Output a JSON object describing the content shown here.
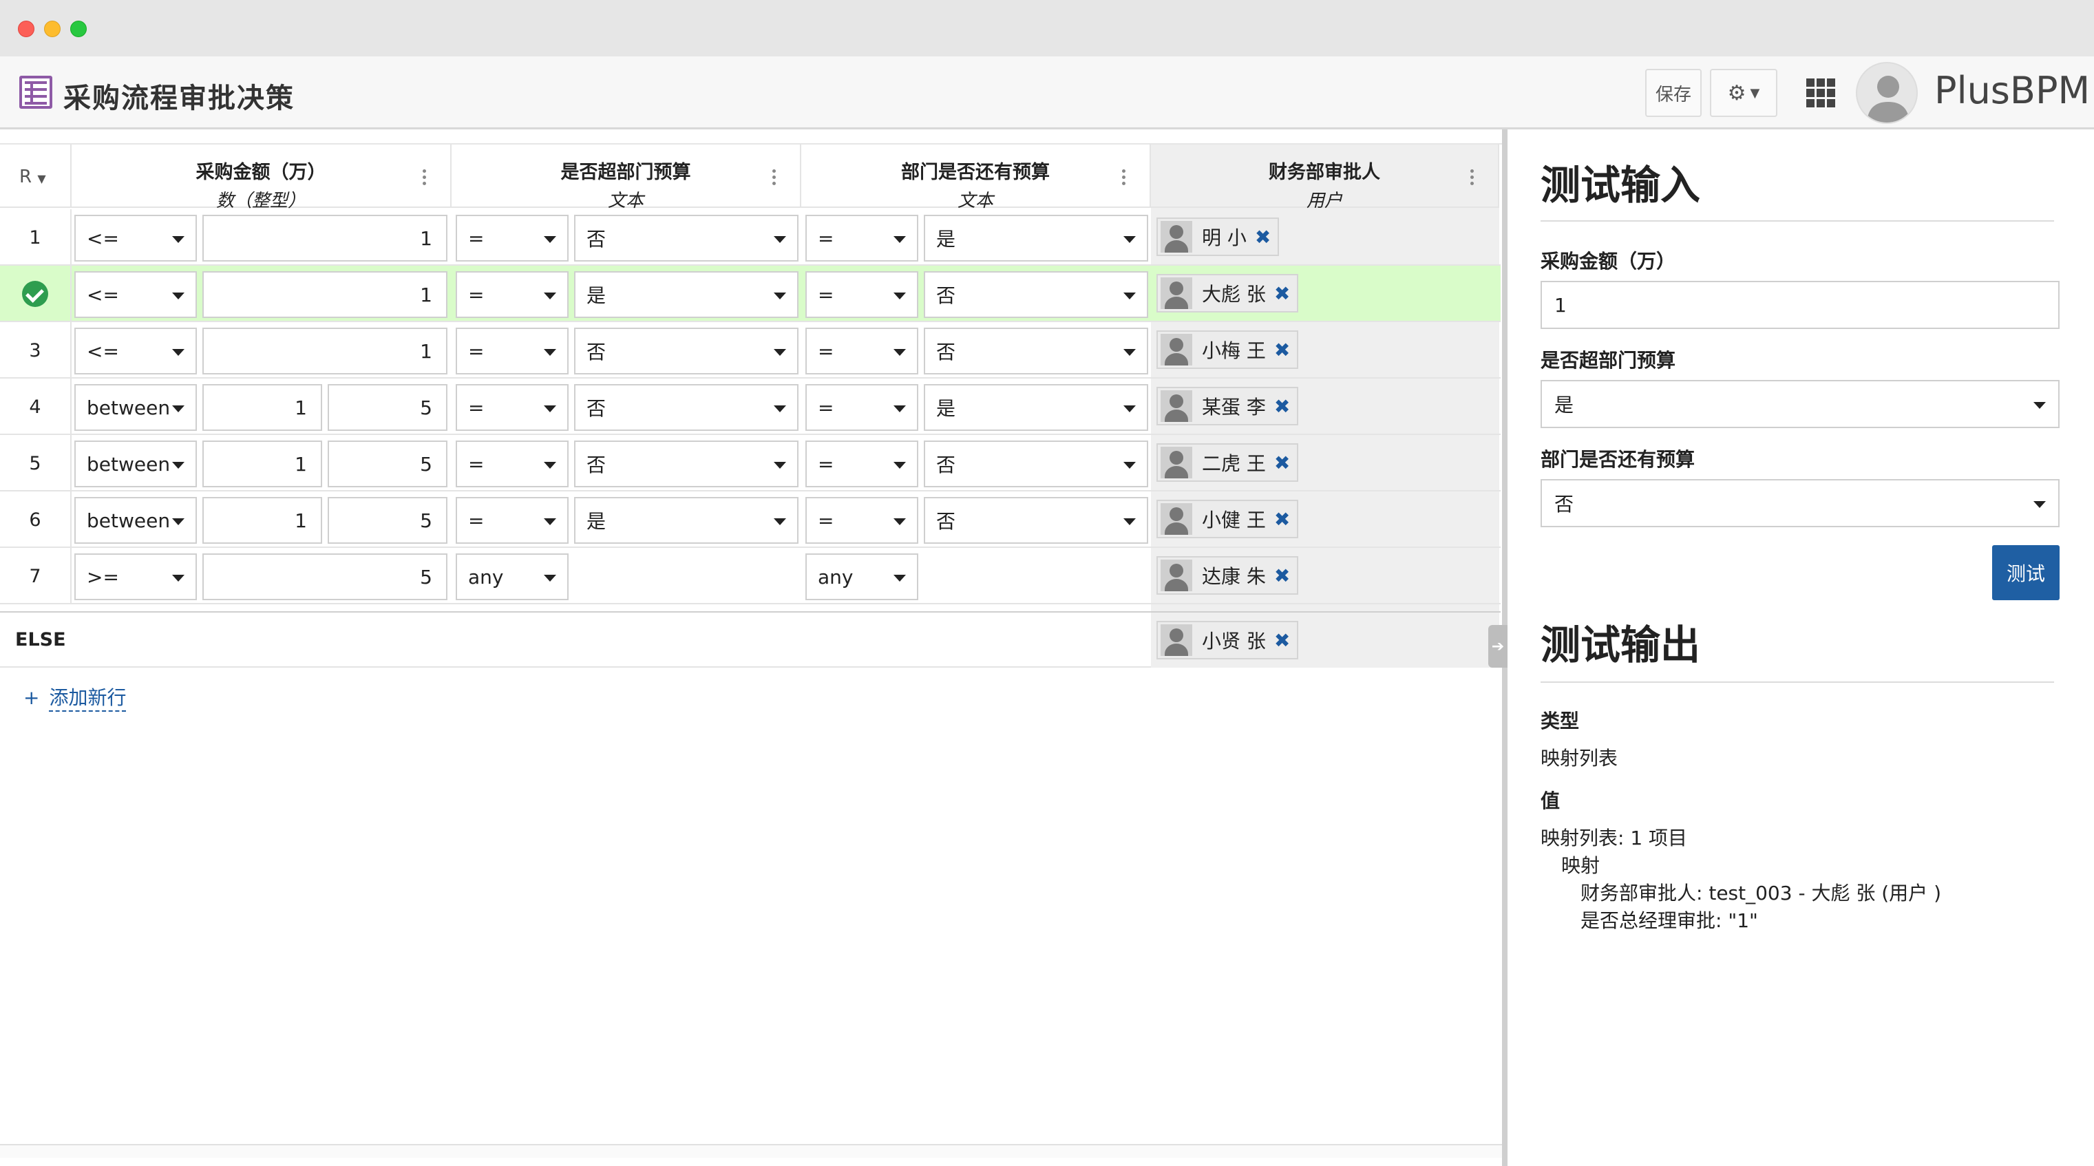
{
  "header": {
    "title": "采购流程审批决策",
    "save_label": "保存",
    "gear_label": "⚙",
    "brand": "PlusBPM"
  },
  "table": {
    "row_header": "R",
    "columns": [
      {
        "name": "采购金额（万）",
        "type": "数（整型）"
      },
      {
        "name": "是否超部门预算",
        "type": "文本"
      },
      {
        "name": "部门是否还有预算",
        "type": "文本"
      },
      {
        "name": "财务部审批人",
        "type": "用户"
      }
    ],
    "rows": [
      {
        "id": "1",
        "op1": "<=",
        "v1a": "1",
        "v1b": "",
        "op2": "=",
        "v2": "否",
        "op3": "=",
        "v3": "是",
        "user": "明 小",
        "active": false
      },
      {
        "id": "2",
        "op1": "<=",
        "v1a": "1",
        "v1b": "",
        "op2": "=",
        "v2": "是",
        "op3": "=",
        "v3": "否",
        "user": "大彪 张",
        "active": true
      },
      {
        "id": "3",
        "op1": "<=",
        "v1a": "1",
        "v1b": "",
        "op2": "=",
        "v2": "否",
        "op3": "=",
        "v3": "否",
        "user": "小梅 王",
        "active": false
      },
      {
        "id": "4",
        "op1": "between",
        "v1a": "1",
        "v1b": "5",
        "op2": "=",
        "v2": "否",
        "op3": "=",
        "v3": "是",
        "user": "某蛋 李",
        "active": false
      },
      {
        "id": "5",
        "op1": "between",
        "v1a": "1",
        "v1b": "5",
        "op2": "=",
        "v2": "否",
        "op3": "=",
        "v3": "否",
        "user": "二虎 王",
        "active": false
      },
      {
        "id": "6",
        "op1": "between",
        "v1a": "1",
        "v1b": "5",
        "op2": "=",
        "v2": "是",
        "op3": "=",
        "v3": "否",
        "user": "小健 王",
        "active": false
      },
      {
        "id": "7",
        "op1": ">=",
        "v1a": "5",
        "v1b": "",
        "op2": "any",
        "v2": "",
        "op3": "any",
        "v3": "",
        "user": "达康 朱",
        "active": false
      }
    ],
    "else_label": "ELSE",
    "else_user": "小贤 张",
    "remove_glyph": "✖",
    "add_row_label": "添加新行",
    "add_row_glyph": "+"
  },
  "panel": {
    "input_title": "测试输入",
    "field1_label": "采购金额（万）",
    "field1_value": "1",
    "field2_label": "是否超部门预算",
    "field2_value": "是",
    "field3_label": "部门是否还有预算",
    "field3_value": "否",
    "test_button": "测试",
    "output_title": "测试输出",
    "type_label": "类型",
    "type_value": "映射列表",
    "value_label": "值",
    "value_line1": "映射列表: 1 项目",
    "value_line2": "映射",
    "value_line3": "财务部审批人: test_003 - 大彪 张 (用户 )",
    "value_line4": "是否总经理审批: \"1\""
  }
}
